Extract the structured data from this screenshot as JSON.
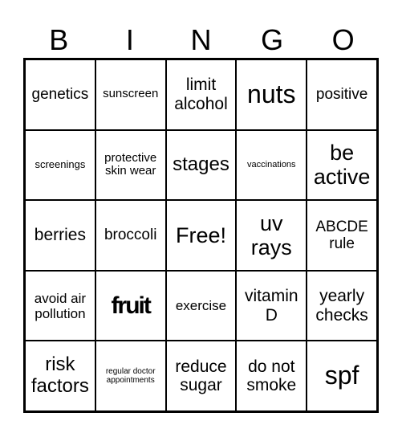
{
  "header": [
    "B",
    "I",
    "N",
    "G",
    "O"
  ],
  "cells": [
    "genetics",
    "sunscreen",
    "limit alcohol",
    "nuts",
    "positive",
    "screenings",
    "protective skin wear",
    "stages",
    "vaccinations",
    "be active",
    "berries",
    "broccoli",
    "Free!",
    "uv rays",
    "ABCDE rule",
    "avoid air pollution",
    "fruit",
    "exercise",
    "vitamin D",
    "yearly checks",
    "risk factors",
    "regular doctor appointments",
    "reduce sugar",
    "do not smoke",
    "spf"
  ]
}
